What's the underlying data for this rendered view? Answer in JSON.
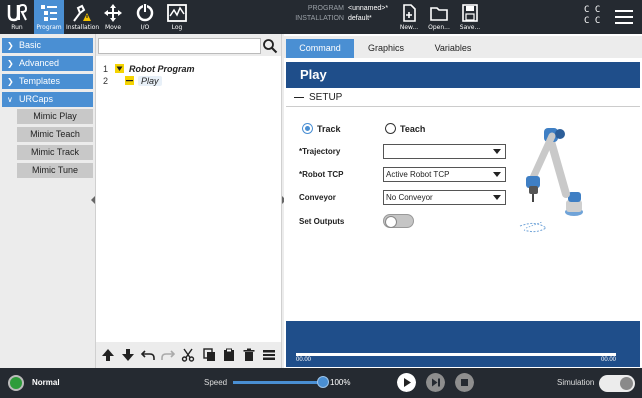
{
  "topbar": {
    "buttons": [
      {
        "label": "Run",
        "icon": "ur-logo-icon"
      },
      {
        "label": "Program",
        "icon": "program-icon",
        "active": true
      },
      {
        "label": "Installation",
        "icon": "installation-icon"
      },
      {
        "label": "Move",
        "icon": "move-icon"
      },
      {
        "label": "I/O",
        "icon": "io-icon"
      },
      {
        "label": "Log",
        "icon": "log-icon"
      }
    ],
    "program_key": "PROGRAM",
    "program_value": "<unnamed>*",
    "installation_key": "INSTALLATION",
    "installation_value": "default*",
    "file_buttons": [
      {
        "label": "New...",
        "icon": "new-file-icon"
      },
      {
        "label": "Open...",
        "icon": "open-folder-icon"
      },
      {
        "label": "Save...",
        "icon": "save-icon"
      }
    ],
    "cc_label": "C C",
    "cc_label2": "C C"
  },
  "sidebar": {
    "items": [
      {
        "label": "Basic"
      },
      {
        "label": "Advanced"
      },
      {
        "label": "Templates"
      },
      {
        "label": "URCaps"
      }
    ],
    "subitems": [
      "Mimic Play",
      "Mimic Teach",
      "Mimic Track",
      "Mimic Tune"
    ]
  },
  "tree": {
    "rows": [
      {
        "num": "1",
        "label": "Robot Program"
      },
      {
        "num": "2",
        "label": "Play"
      }
    ]
  },
  "tabs": [
    "Command",
    "Graphics",
    "Variables"
  ],
  "node": {
    "title": "Play",
    "setup_label": "SETUP",
    "radio_track": "Track",
    "radio_teach": "Teach",
    "trajectory_label": "*Trajectory",
    "trajectory_value": "",
    "tcp_label": "*Robot TCP",
    "tcp_value": "Active Robot TCP",
    "conveyor_label": "Conveyor",
    "conveyor_value": "No Conveyor",
    "outputs_label": "Set Outputs",
    "time_start": "00.00",
    "time_end": "00.00"
  },
  "bottombar": {
    "status": "Normal",
    "speed_label": "Speed",
    "speed_value": "100%",
    "speed_fraction": 1.0,
    "simulation_label": "Simulation"
  },
  "colors": {
    "accent": "#4a8fd3",
    "dark_bar": "#252a31",
    "node_bar": "#1f4e8a",
    "status_green": "#2e9c3a"
  }
}
